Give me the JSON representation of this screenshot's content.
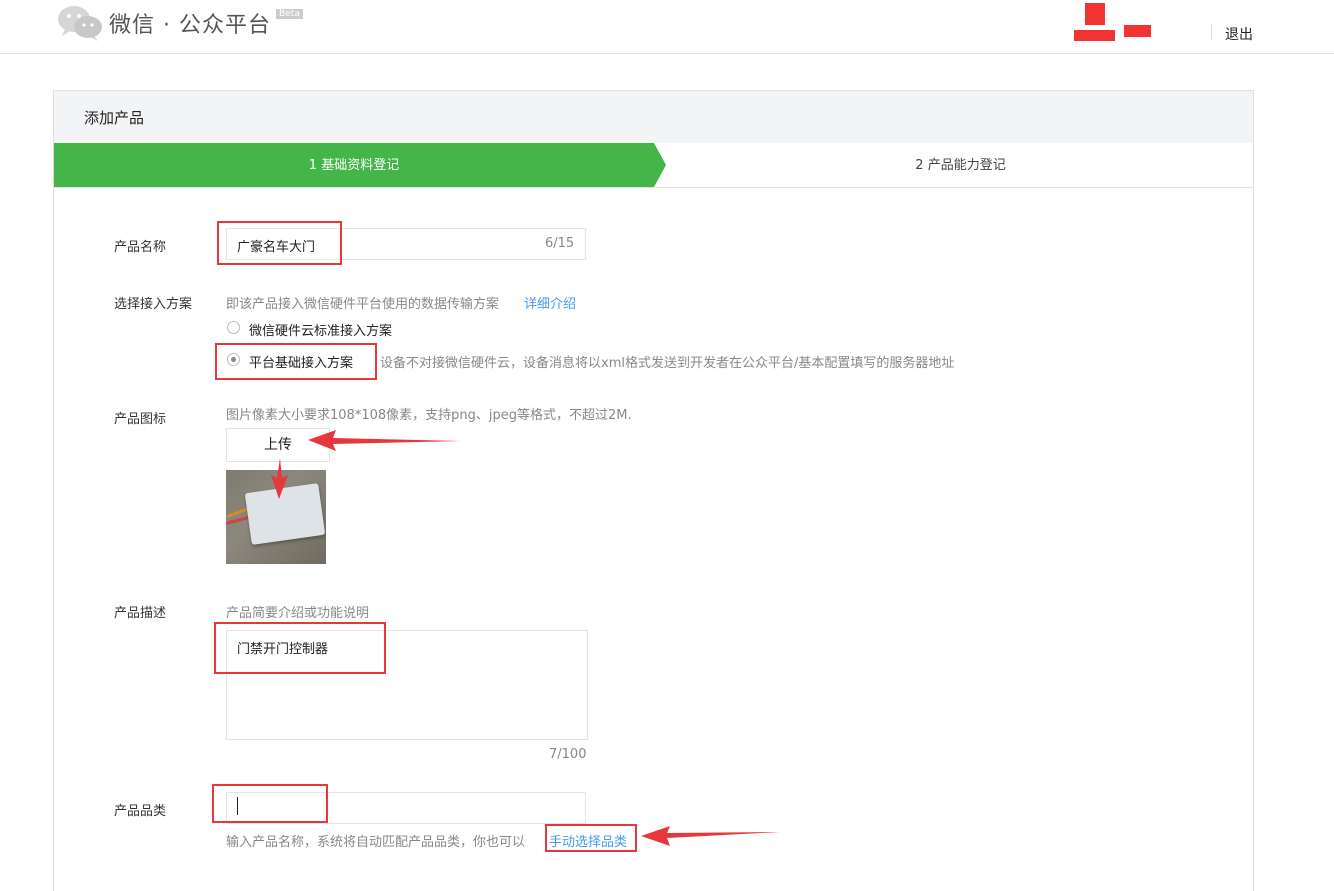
{
  "header": {
    "logo_text": "微信 · 公众平台",
    "beta_badge": "Beta",
    "logout": "退出"
  },
  "page": {
    "title": "添加产品"
  },
  "steps": [
    {
      "label": "1 基础资料登记",
      "active": true
    },
    {
      "label": "2 产品能力登记",
      "active": false
    }
  ],
  "form": {
    "product_name": {
      "label": "产品名称",
      "value": "广豪名车大门",
      "counter": "6/15"
    },
    "access_scheme": {
      "label": "选择接入方案",
      "hint": "即该产品接入微信硬件平台使用的数据传输方案",
      "detail_link": "详细介绍",
      "options": [
        {
          "label": "微信硬件云标准接入方案",
          "checked": false,
          "desc": ""
        },
        {
          "label": "平台基础接入方案",
          "checked": true,
          "desc": "设备不对接微信硬件云，设备消息将以xml格式发送到开发者在公众平台/基本配置填写的服务器地址"
        }
      ]
    },
    "product_icon": {
      "label": "产品图标",
      "hint": "图片像素大小要求108*108像素，支持png、jpeg等格式，不超过2M.",
      "upload_button": "上传"
    },
    "product_description": {
      "label": "产品描述",
      "hint": "产品简要介绍或功能说明",
      "value": "门禁开门控制器",
      "counter": "7/100"
    },
    "product_category": {
      "label": "产品品类",
      "value": "",
      "hint": "输入产品名称，系统将自动匹配产品品类，你也可以",
      "manual_link": "手动选择品类"
    }
  },
  "colors": {
    "brand_green": "#44b549",
    "link_blue": "#459ae9",
    "annotation_red": "#e8373c"
  }
}
